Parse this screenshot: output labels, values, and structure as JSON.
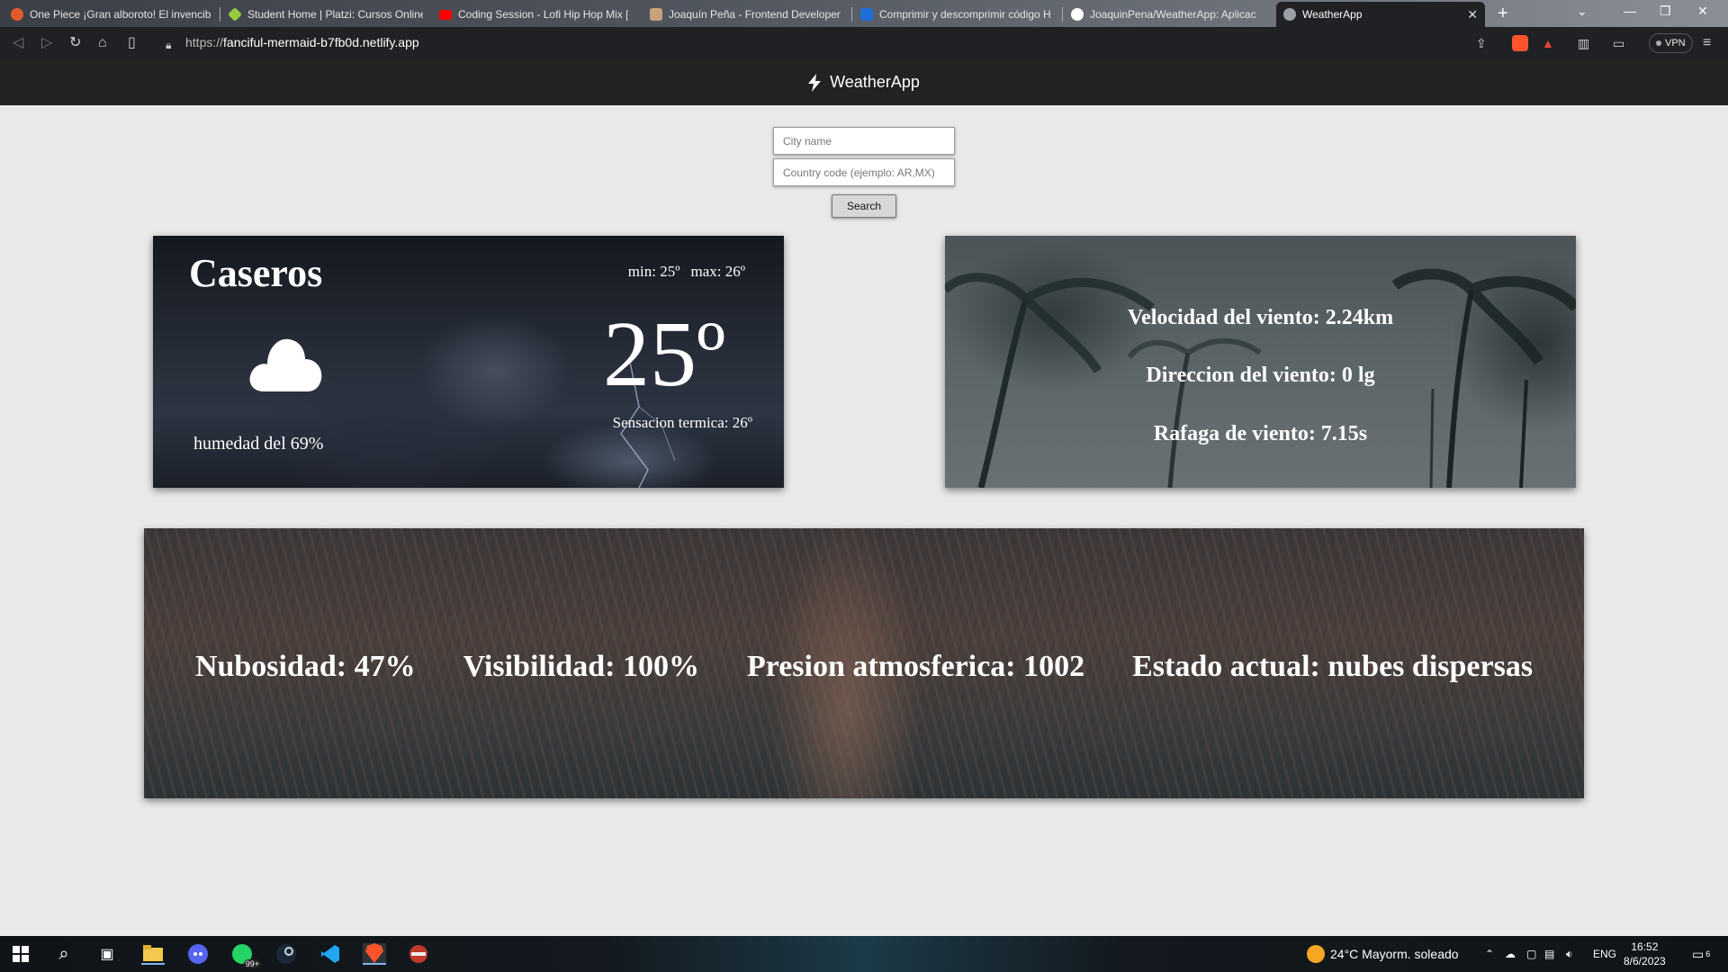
{
  "browser": {
    "tabs": [
      {
        "title": "One Piece ¡Gran alboroto! El invencib",
        "color": "#e0592a"
      },
      {
        "title": "Student Home | Platzi: Cursos Online",
        "color": "#98ca3f"
      },
      {
        "title": "Coding Session - Lofi Hip Hop Mix [",
        "color": "#ff0000"
      },
      {
        "title": "Joaquín Peña - Frontend Developer",
        "color": "#c8a27a"
      },
      {
        "title": "Comprimir y descomprimir código H",
        "color": "#1e6fd9"
      },
      {
        "title": "JoaquinPena/WeatherApp: Aplicac",
        "color": "#ffffff"
      },
      {
        "title": "WeatherApp",
        "color": "#9aa0a6"
      }
    ],
    "url_prefix": "https://",
    "url_host": "fanciful-mermaid-b7fb0d.netlify.app",
    "vpn_label": "VPN"
  },
  "header": {
    "title": "WeatherApp"
  },
  "search": {
    "city_placeholder": "City name",
    "country_placeholder": "Country code (ejemplo: AR,MX)",
    "button_label": "Search"
  },
  "weather": {
    "city": "Caseros",
    "min": "min: 25º",
    "max": "max: 26º",
    "temp": "25º",
    "feels_like": "Sensacion termica: 26º",
    "humidity": "humedad del 69%",
    "icon": "cloud-icon"
  },
  "wind": {
    "speed": "Velocidad del viento: 2.24km",
    "direction": "Direccion del viento: 0 lg",
    "gust": "Rafaga de viento: 7.15s"
  },
  "details": {
    "clouds": "Nubosidad: 47%",
    "visibility": "Visibilidad: 100%",
    "pressure": "Presion atmosferica: 1002",
    "state": "Estado actual: nubes dispersas"
  },
  "taskbar": {
    "weather": "24°C  Mayorm. soleado",
    "lang": "ENG",
    "time": "16:52",
    "date": "8/6/2023",
    "whatsapp_badge": "99+",
    "notif_count": "6"
  }
}
